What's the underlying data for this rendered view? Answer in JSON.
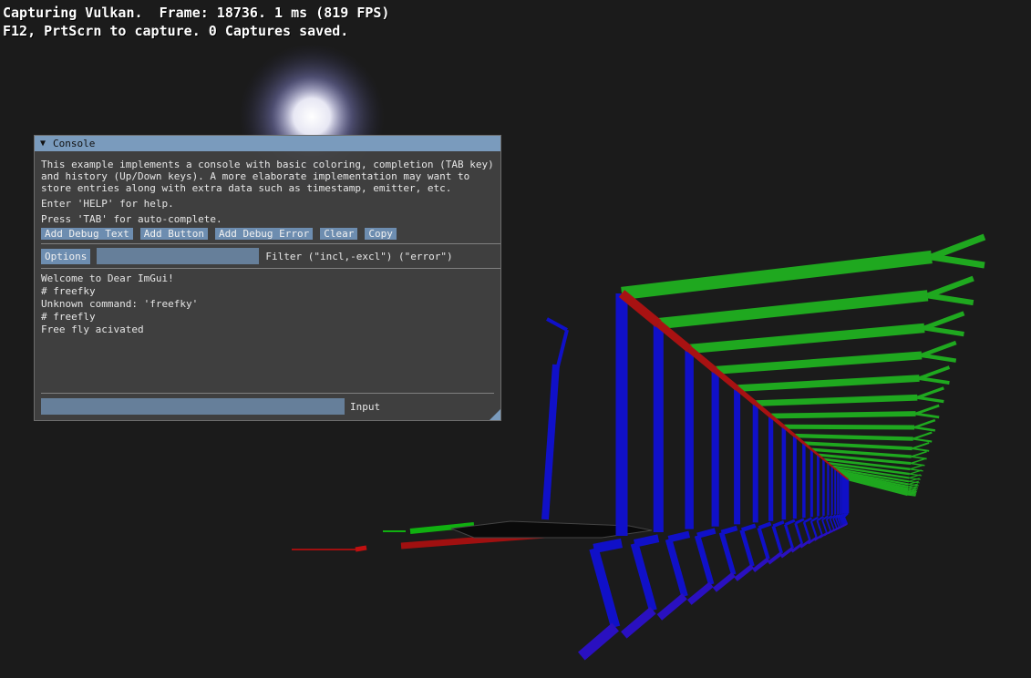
{
  "overlay": {
    "line1": "Capturing Vulkan.  Frame: 18736. 1 ms (819 FPS)",
    "line2": "F12, PrtScrn to capture. 0 Captures saved."
  },
  "console": {
    "title": "Console",
    "description": "This example implements a console with basic coloring, completion (TAB key) and history (Up/Down keys). A more elaborate implementation may want to store entries along with extra data such as timestamp, emitter, etc.",
    "help_hint": "Enter 'HELP' for help.",
    "tab_hint": "Press 'TAB' for auto-complete.",
    "buttons": {
      "add_debug_text": "Add Debug Text",
      "add_button": "Add Button",
      "add_debug_error": "Add Debug Error",
      "clear": "Clear",
      "copy": "Copy"
    },
    "options_label": "Options",
    "filter_value": "",
    "filter_label": "Filter (\"incl,-excl\") (\"error\")",
    "log": [
      "Welcome to Dear ImGui!",
      "# freefky",
      "Unknown command: 'freefky'",
      "# freefly",
      "Free fly acivated"
    ],
    "input_value": "",
    "input_label": "Input"
  },
  "colors": {
    "background": "#1b1b1b",
    "title_bar": "#7a9bbd",
    "button": "#6d8db0",
    "axis_x": "#a01010",
    "axis_y": "#10b010",
    "axis_z": "#1010c8"
  }
}
